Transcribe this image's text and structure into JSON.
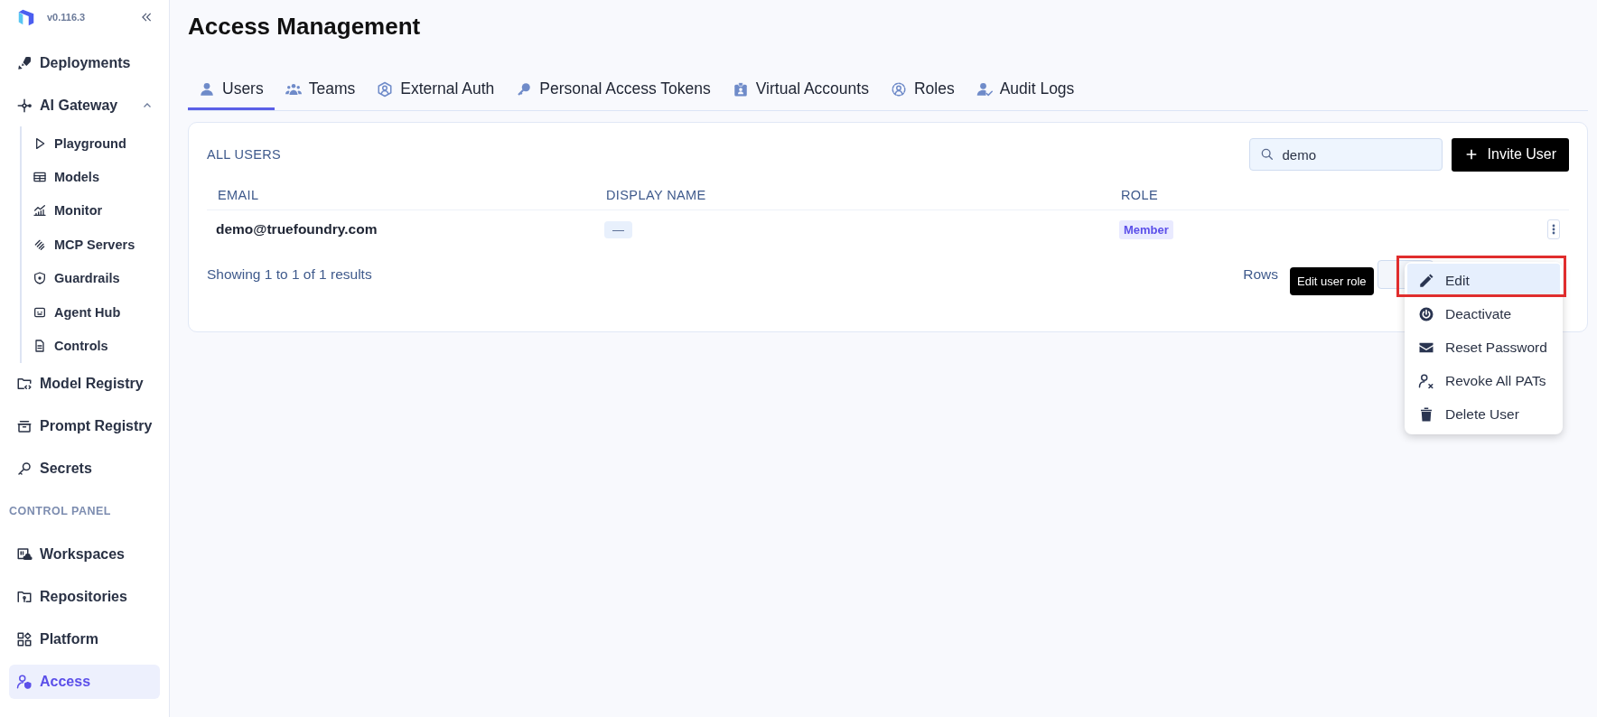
{
  "sidebar": {
    "version": "v0.116.3",
    "items": [
      {
        "kind": "item",
        "label": "Deployments",
        "selected": false
      },
      {
        "kind": "group",
        "label": "AI Gateway",
        "selected": false,
        "expanded": true,
        "children": [
          {
            "kind": "item",
            "label": "Playground",
            "selected": false
          },
          {
            "kind": "item",
            "label": "Models",
            "selected": false
          },
          {
            "kind": "item",
            "label": "Monitor",
            "selected": false
          },
          {
            "kind": "item",
            "label": "MCP Servers",
            "selected": false
          },
          {
            "kind": "item",
            "label": "Guardrails",
            "selected": false
          },
          {
            "kind": "item",
            "label": "Agent Hub",
            "selected": false
          },
          {
            "kind": "item",
            "label": "Controls",
            "selected": false
          }
        ]
      },
      {
        "kind": "item",
        "label": "Model Registry",
        "selected": false
      },
      {
        "kind": "item",
        "label": "Prompt Registry",
        "selected": false
      },
      {
        "kind": "item",
        "label": "Secrets",
        "selected": false
      },
      {
        "kind": "section",
        "label": "CONTROL PANEL"
      },
      {
        "kind": "item",
        "label": "Workspaces",
        "selected": false
      },
      {
        "kind": "item",
        "label": "Repositories",
        "selected": false
      },
      {
        "kind": "item",
        "label": "Platform",
        "selected": false
      },
      {
        "kind": "item",
        "label": "Access",
        "selected": true
      }
    ]
  },
  "page": {
    "title": "Access Management"
  },
  "tabs": [
    {
      "label": "Users",
      "selected": true
    },
    {
      "label": "Teams",
      "selected": false
    },
    {
      "label": "External Auth",
      "selected": false
    },
    {
      "label": "Personal Access Tokens",
      "selected": false
    },
    {
      "label": "Virtual Accounts",
      "selected": false
    },
    {
      "label": "Roles",
      "selected": false
    },
    {
      "label": "Audit Logs",
      "selected": false
    }
  ],
  "card": {
    "title": "ALL USERS",
    "search": {
      "value": "demo"
    },
    "invite_button": "Invite User",
    "columns": [
      "EMAIL",
      "DISPLAY NAME",
      "ROLE"
    ],
    "rows": [
      {
        "email": "demo@truefoundry.com",
        "display_name": "—",
        "role": "Member"
      }
    ],
    "footer": "Showing 1 to 1 of 1 results",
    "rows_per_page": "Rows"
  },
  "menu": {
    "tooltip": "Edit user role",
    "items": [
      {
        "label": "Edit",
        "selected": true
      },
      {
        "label": "Deactivate",
        "selected": false
      },
      {
        "label": "Reset Password",
        "selected": false
      },
      {
        "label": "Revoke All PATs",
        "selected": false
      },
      {
        "label": "Delete User",
        "selected": false
      }
    ]
  }
}
